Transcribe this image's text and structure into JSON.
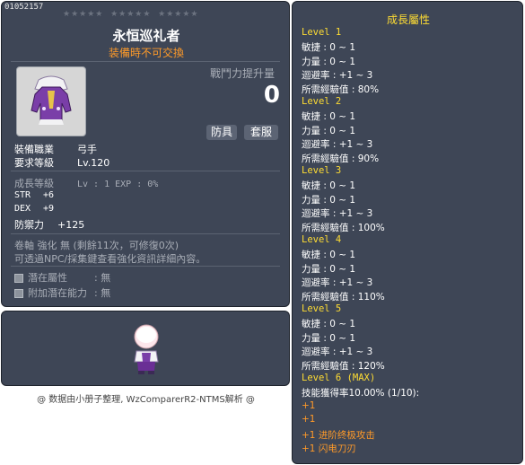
{
  "item": {
    "id": "01052157",
    "name": "永恒巡礼者",
    "trade_note": "装備時不可交換",
    "icon": "overall-armor-icon",
    "power_label": "戰鬥力提升量",
    "power_value": "0",
    "tags": [
      "防具",
      "套服"
    ],
    "job_label": "裝備職業",
    "job_value": "弓手",
    "level_label": "要求等級",
    "level_value": "Lv.120",
    "growth_label": "成長等級",
    "growth_value": "Lv : 1  EXP : 0%",
    "stats": [
      {
        "label": "STR",
        "value": "+6"
      },
      {
        "label": "DEX",
        "value": "+9"
      }
    ],
    "defense_label": "防禦力",
    "defense_value": "+125",
    "scroll_line": "卷軸 強化 無 (剩餘11次，可修復0次)",
    "info_line": "可透過NPC/採集鍵查看強化資訊詳細內容。",
    "potential": [
      {
        "label": "潛在屬性",
        "value": ": 無"
      },
      {
        "label": "附加潛在能力",
        "value": ": 無"
      }
    ]
  },
  "preview": {
    "icon": "character-preview-icon"
  },
  "footer": "@ 数据由小册子整理, WzComparerR2-NTMS解析 @",
  "growth": {
    "title": "成長屬性",
    "levels": [
      {
        "title": "Level 1",
        "lines": [
          "敏捷 : 0 ~ 1",
          "力量 : 0 ~ 1",
          "迴避率 : +1 ~ 3",
          "所需經驗值 : 80%"
        ]
      },
      {
        "title": "Level 2",
        "lines": [
          "敏捷 : 0 ~ 1",
          "力量 : 0 ~ 1",
          "迴避率 : +1 ~ 3",
          "所需經驗值 : 90%"
        ]
      },
      {
        "title": "Level 3",
        "lines": [
          "敏捷 : 0 ~ 1",
          "力量 : 0 ~ 1",
          "迴避率 : +1 ~ 3",
          "所需經驗值 : 100%"
        ]
      },
      {
        "title": "Level 4",
        "lines": [
          "敏捷 : 0 ~ 1",
          "力量 : 0 ~ 1",
          "迴避率 : +1 ~ 3",
          "所需經驗值 : 110%"
        ]
      },
      {
        "title": "Level 5",
        "lines": [
          "敏捷 : 0 ~ 1",
          "力量 : 0 ~ 1",
          "迴避率 : +1 ~ 3",
          "所需經驗值 : 120%"
        ]
      }
    ],
    "max": {
      "title": "Level 6 (MAX)",
      "skill_line": "技能獲得率10.00% (1/10):",
      "skills": [
        "+1",
        "+1",
        "+1 进阶终极攻击",
        "+1 闪电刀刃"
      ]
    }
  },
  "colors": {
    "panel": "#3e4656",
    "yellow": "#ffdd33",
    "orange": "#ff9a28",
    "gray": "#a8adb6"
  }
}
